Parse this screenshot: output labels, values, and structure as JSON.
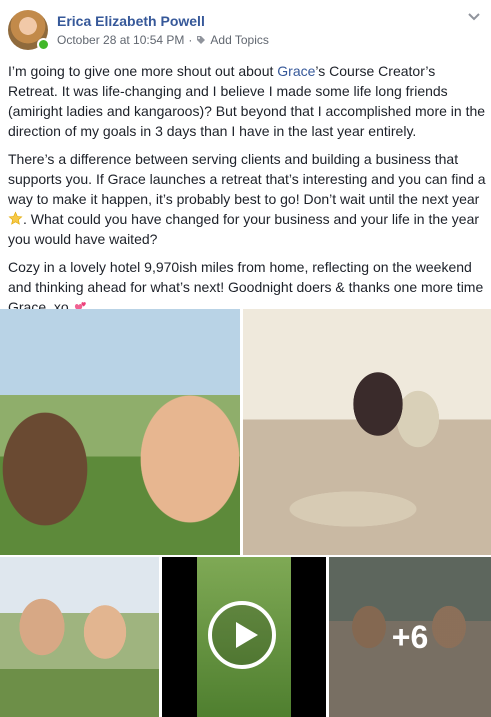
{
  "post": {
    "author": "Erica Elizabeth Powell",
    "timestamp": "October 28 at 10:54 PM",
    "separator": "·",
    "add_topics": "Add Topics",
    "paragraphs": [
      {
        "before": "I’m going to give one more shout out about ",
        "link": "Grace",
        "after": "’s Course Creator’s Retreat. It was life-changing and I believe I made some life long friends (amiright ladies and kangaroos)? But beyond that I accomplished more in the direction of my goals in 3 days than I have in the last year entirely."
      },
      {
        "before": "There’s a difference between serving clients and building a business that supports you. If Grace launches a retreat that’s interesting and you can find a way to make it happen, it’s probably best to go! Don’t wait until the next year ",
        "emoji": "star-emoji",
        "after": ". What could you have changed for your business and your life in the year you would have waited?"
      },
      {
        "before": "Cozy in a lovely hotel 9,970ish miles from home, reflecting on the weekend and thinking ahead for what’s next! Goodnight doers & thanks one more time Grace. xo ",
        "emoji": "two-hearts-emoji"
      }
    ],
    "more_photos": "+6"
  },
  "colors": {
    "link": "#365899",
    "text": "#1d2129",
    "meta": "#616770",
    "online": "#42b72a"
  }
}
